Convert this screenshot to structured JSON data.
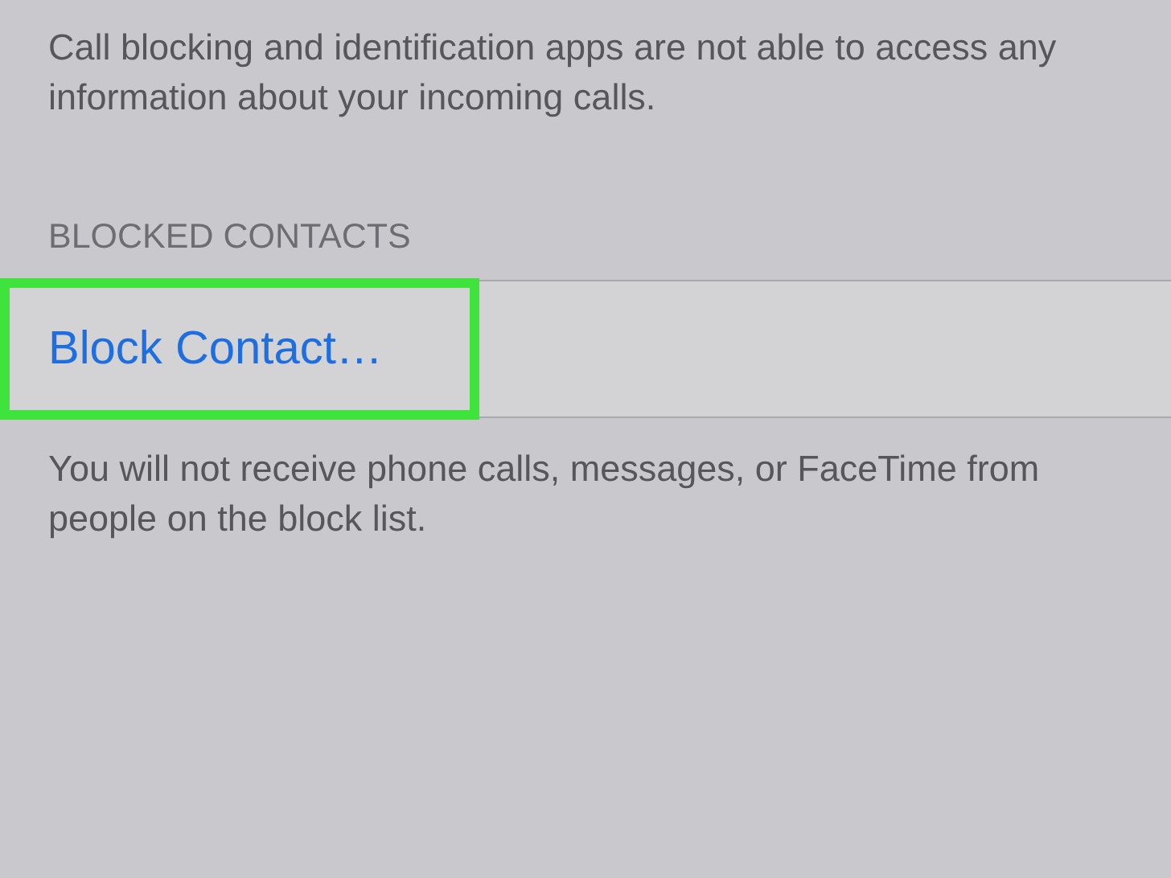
{
  "privacy_note": "Call blocking and identification apps are not able to access any information about your incoming calls.",
  "section_header": "BLOCKED CONTACTS",
  "block_contact_button": {
    "label": "Block Contact…",
    "highlighted": true
  },
  "footer_note": "You will not receive phone calls, messages, or FaceTime from people on the block list."
}
